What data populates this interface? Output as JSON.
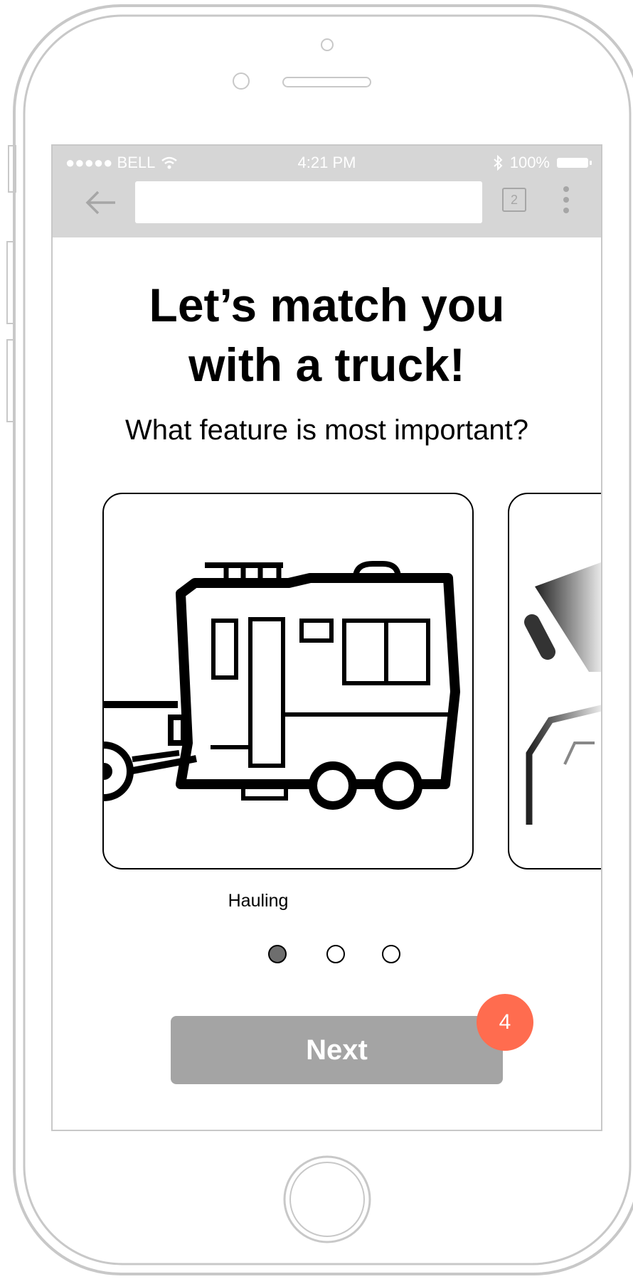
{
  "status_bar": {
    "signal": "●●●●● BELL",
    "time": "4:21 PM",
    "battery": "100%"
  },
  "browser": {
    "url": "",
    "tab_count": "2"
  },
  "main": {
    "title_line1": "Let’s match you",
    "title_line2": "with a truck!",
    "question": "What feature is most important?",
    "cards": [
      {
        "label": "Hauling",
        "icon": "trailer-icon"
      },
      {
        "label": "",
        "icon": "partial-card-icon"
      }
    ],
    "pagination": {
      "count": 3,
      "active_index": 0
    },
    "next_label": "Next",
    "badge": "4"
  },
  "colors": {
    "accent": "#ff6c4f",
    "button": "#a4a4a4",
    "chrome": "#d6d6d6"
  }
}
